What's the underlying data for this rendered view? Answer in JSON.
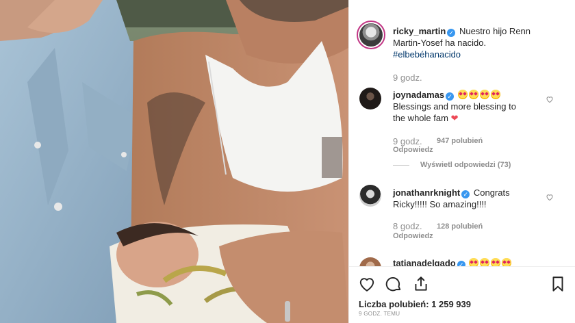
{
  "post": {
    "author": "ricky_martin",
    "caption": "Nuestro hijo Renn",
    "caption_line2": "Martin-Yosef ha nacido.",
    "hashtag": "#elbebéhanacido",
    "time": "9 godz."
  },
  "comments": [
    {
      "user": "joynadamas",
      "line1": "Blessings and more blessing to",
      "line2": "the whole fam",
      "time": "9 godz.",
      "likes": "947 polubień",
      "reply": "Odpowiedz",
      "view_replies": "Wyświetl odpowiedzi (73)"
    },
    {
      "user": "jonathanrknight",
      "line1": "Congrats",
      "line2": "Ricky!!!!! So amazing!!!!",
      "time": "8 godz.",
      "likes": "128 polubień",
      "reply": "Odpowiedz"
    },
    {
      "user": "tatianadelgado"
    }
  ],
  "footer": {
    "likes": "Liczba polubień: 1 259 939",
    "ago": "9 godz. temu"
  },
  "icons": [
    "like-icon",
    "comment-icon",
    "share-icon",
    "bookmark-icon",
    "verified-icon"
  ],
  "colors": {
    "link": "#00376b",
    "verified": "#3897f0",
    "muted": "#8e8e8e",
    "heart": "#ed4956"
  }
}
